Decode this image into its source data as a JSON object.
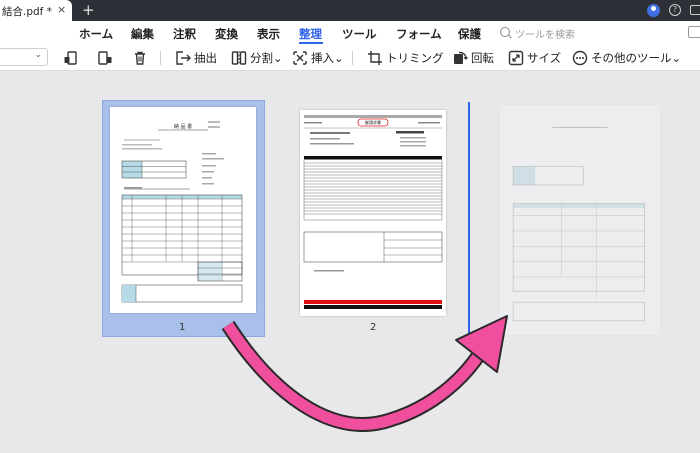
{
  "titlebar": {
    "tab_title": "結合.pdf *",
    "close_glyph": "×",
    "add_glyph": "+",
    "help_glyph": "?",
    "icons": [
      "close-icon",
      "add-tab-icon",
      "account-icon",
      "help-icon",
      "message-icon"
    ]
  },
  "ribbon": {
    "tabs": [
      {
        "label": "ホーム"
      },
      {
        "label": "編集"
      },
      {
        "label": "注釈"
      },
      {
        "label": "変換"
      },
      {
        "label": "表示"
      },
      {
        "label": "整理",
        "active": true
      },
      {
        "label": "ツール"
      },
      {
        "label": "フォーム"
      },
      {
        "label": "保護"
      }
    ],
    "search_placeholder": "ツールを検索"
  },
  "toolbar": {
    "zoom_caret": "⌄",
    "buttons": [
      {
        "label": "",
        "icon": "rotate-left-icon"
      },
      {
        "label": "",
        "icon": "rotate-right-icon"
      },
      {
        "label": "",
        "icon": "trash-icon"
      },
      {
        "label": "抽出",
        "icon": "extract-icon"
      },
      {
        "label": "分割⌄",
        "icon": "split-icon"
      },
      {
        "label": "挿入⌄",
        "icon": "insert-icon"
      },
      {
        "label": "トリミング",
        "icon": "crop-icon"
      },
      {
        "label": "回転",
        "icon": "rotate-icon"
      },
      {
        "label": "サイズ",
        "icon": "resize-icon"
      },
      {
        "label": "その他のツール⌄",
        "icon": "more-tools-icon"
      }
    ]
  },
  "pages": [
    {
      "number": "1",
      "selected": true,
      "title": "納 品 書"
    },
    {
      "number": "2",
      "selected": false,
      "title": "御請求書"
    },
    {
      "number": "",
      "selected": false,
      "ghost": true
    }
  ],
  "colors": {
    "accent": "#2e63e9",
    "selection": "#a9c0ea",
    "arrow": "#f04f9e",
    "titlebar": "#2e3038"
  }
}
